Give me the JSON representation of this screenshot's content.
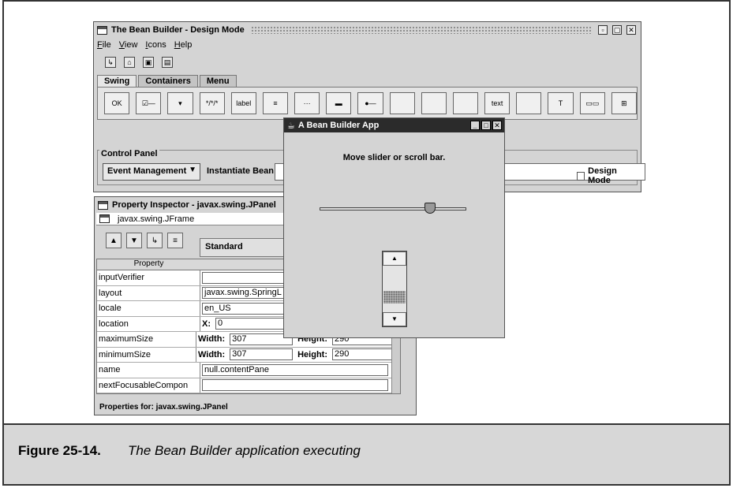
{
  "main_window": {
    "title": "The Bean Builder - Design Mode",
    "menu": [
      "File",
      "View",
      "Icons",
      "Help"
    ],
    "toolbar_icons": [
      "new-file-icon",
      "open-file-icon",
      "save-icon",
      "save-all-icon"
    ],
    "tabs": [
      "Swing",
      "Containers",
      "Menu"
    ],
    "palette_items": [
      {
        "icon": "button-bean-icon",
        "text": "OK"
      },
      {
        "icon": "checkbox-bean-icon",
        "text": "☑—"
      },
      {
        "icon": "combobox-bean-icon",
        "text": "▾"
      },
      {
        "icon": "password-field-icon",
        "text": "*/*/*"
      },
      {
        "icon": "label-bean-icon",
        "text": "label"
      },
      {
        "icon": "list-bean-icon",
        "text": "≡"
      },
      {
        "icon": "textfield-bean-icon",
        "text": "···"
      },
      {
        "icon": "progressbar-bean-icon",
        "text": "▬"
      },
      {
        "icon": "radiobutton-bean-icon",
        "text": "●—"
      },
      {
        "icon": "scrollbar-bean-icon",
        "text": ""
      },
      {
        "icon": "slider-bean-icon",
        "text": ""
      },
      {
        "icon": "spinner-bean-icon",
        "text": ""
      },
      {
        "icon": "textarea-bean-icon",
        "text": "text"
      },
      {
        "icon": "textfield-empty-icon",
        "text": ""
      },
      {
        "icon": "textpane-bean-icon",
        "text": "T"
      },
      {
        "icon": "table-bean-icon",
        "text": "▭▭"
      },
      {
        "icon": "tree-bean-icon",
        "text": "⊞"
      }
    ],
    "control_panel": {
      "title": "Control Panel",
      "combo_value": "Event Management",
      "instantiate_label": "Instantiate Bean",
      "design_mode_label": "Design Mode"
    }
  },
  "inspector": {
    "title": "Property Inspector - javax.swing.JPanel",
    "tree_item": "javax.swing.JFrame",
    "view_combo": "Standard",
    "column_property": "Property",
    "rows": [
      {
        "name": "inputVerifier",
        "value": ""
      },
      {
        "name": "layout",
        "value": "javax.swing.SpringL"
      },
      {
        "name": "locale",
        "value": "en_US"
      },
      {
        "name": "location",
        "x_label": "X:",
        "x": "0"
      },
      {
        "name": "maximumSize",
        "w_label": "Width:",
        "w": "307",
        "h_label": "Height:",
        "h": "290"
      },
      {
        "name": "minimumSize",
        "w_label": "Width:",
        "w": "307",
        "h_label": "Height:",
        "h": "290"
      },
      {
        "name": "name",
        "value": "null.contentPane"
      },
      {
        "name": "nextFocusableCompon",
        "value": ""
      }
    ],
    "status": "Properties for:  javax.swing.JPanel"
  },
  "app": {
    "title": "A Bean Builder App",
    "message": "Move slider or scroll bar.",
    "slider_value_fraction": 0.75,
    "scrollbar_value_fraction": 0.75
  },
  "caption": {
    "label": "Figure  25-14.",
    "text": "The Bean Builder application executing"
  }
}
